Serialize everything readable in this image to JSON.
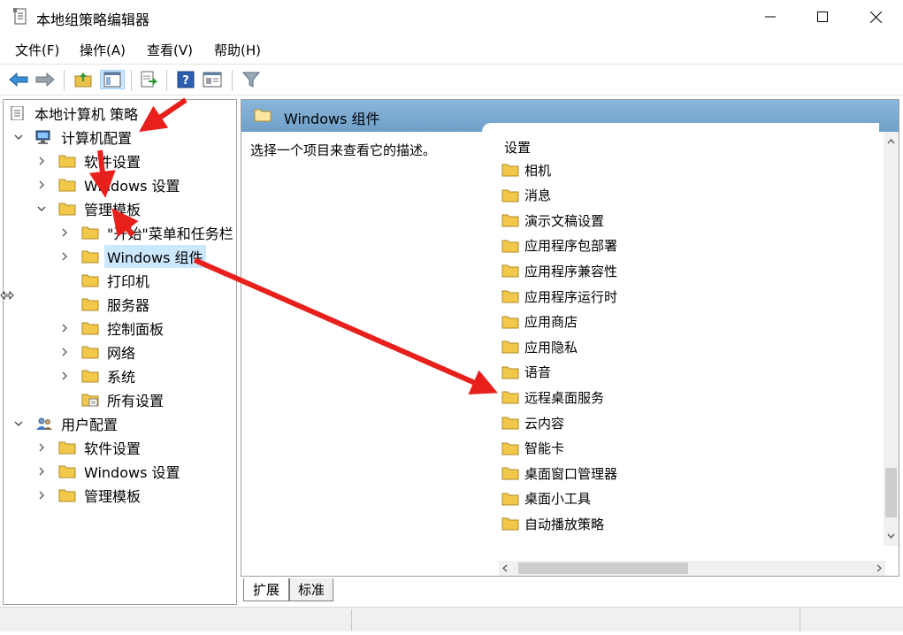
{
  "window": {
    "title": "本地组策略编辑器"
  },
  "menu": [
    {
      "label": "文件(F)"
    },
    {
      "label": "操作(A)"
    },
    {
      "label": "查看(V)"
    },
    {
      "label": "帮助(H)"
    }
  ],
  "toolbar": {
    "icons": [
      "back-arrow-icon",
      "forward-arrow-icon",
      "up-folder-icon",
      "show-hide-tree-icon",
      "export-list-icon",
      "help-icon",
      "properties-icon",
      "filter-icon"
    ]
  },
  "tree": {
    "root": "本地计算机 策略",
    "computer_config": "计算机配置",
    "computer_software": "软件设置",
    "computer_windows": "Windows 设置",
    "admin_templates": "管理模板",
    "start_menu": "\"开始\"菜单和任务栏",
    "windows_components": "Windows 组件",
    "printers": "打印机",
    "servers": "服务器",
    "control_panel": "控制面板",
    "network": "网络",
    "system": "系统",
    "all_settings": "所有设置",
    "user_config": "用户配置",
    "user_software": "软件设置",
    "user_windows": "Windows 设置",
    "user_admin": "管理模板"
  },
  "right_pane": {
    "header_title": "Windows 组件",
    "description": "选择一个项目来查看它的描述。",
    "column_header": "设置",
    "items": [
      "相机",
      "消息",
      "演示文稿设置",
      "应用程序包部署",
      "应用程序兼容性",
      "应用程序运行时",
      "应用商店",
      "应用隐私",
      "语音",
      "远程桌面服务",
      "云内容",
      "智能卡",
      "桌面窗口管理器",
      "桌面小工具",
      "自动播放策略"
    ]
  },
  "tabs": [
    {
      "label": "扩展",
      "active": true
    },
    {
      "label": "标准",
      "active": false
    }
  ],
  "colors": {
    "header_gradient_top": "#8ab6d9",
    "selection": "#cce8ff",
    "folder": "#f2c84b",
    "annotation_arrow": "#e8201c"
  },
  "scroll": {
    "vertical_position_fraction": 0.83,
    "horizontal_position_fraction": 0.0
  }
}
